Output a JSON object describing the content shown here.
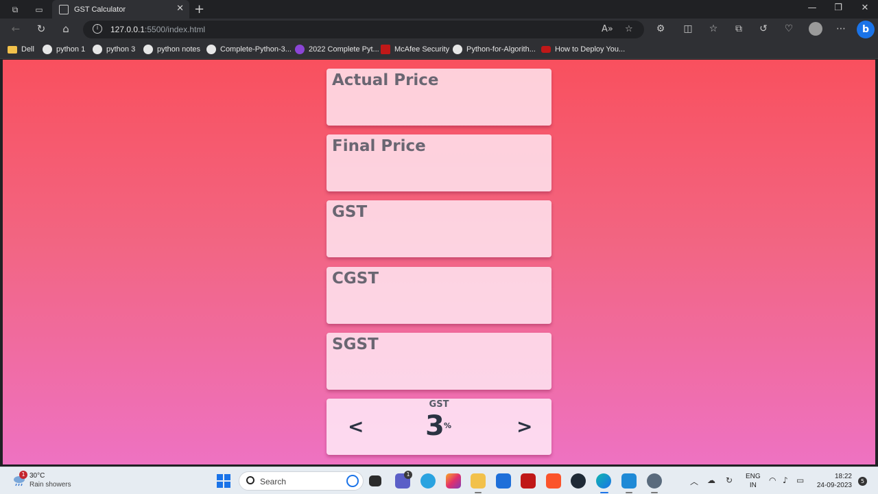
{
  "browser": {
    "tab_title": "GST Calculator",
    "url_host": "127.0.0.1",
    "url_rest": ":5500/index.html",
    "bookmarks": [
      {
        "label": "Dell",
        "icon": "folder-icon"
      },
      {
        "label": "python 1",
        "icon": "github-icon"
      },
      {
        "label": "python 3",
        "icon": "github-icon"
      },
      {
        "label": "python notes",
        "icon": "github-icon"
      },
      {
        "label": "Complete-Python-3...",
        "icon": "github-icon"
      },
      {
        "label": "2022 Complete Pyt...",
        "icon": "udemy-icon"
      },
      {
        "label": "McAfee Security",
        "icon": "mcafee-icon"
      },
      {
        "label": "Python-for-Algorith...",
        "icon": "github-icon"
      },
      {
        "label": "How to Deploy You...",
        "icon": "youtube-icon"
      }
    ]
  },
  "app": {
    "cards": [
      {
        "label": "Actual Price"
      },
      {
        "label": "Final Price"
      },
      {
        "label": "GST"
      },
      {
        "label": "CGST"
      },
      {
        "label": "SGST"
      }
    ],
    "selector": {
      "label": "GST",
      "value": "3",
      "unit": "%",
      "prev": "<",
      "next": ">"
    }
  },
  "taskbar": {
    "weather_temp": "30°C",
    "weather_desc": "Rain showers",
    "weather_badge": "1",
    "search_placeholder": "Search",
    "teams_badge": "1",
    "lang_1": "ENG",
    "lang_2": "IN",
    "time": "18:22",
    "date": "24-09-2023",
    "notifications": "5"
  }
}
